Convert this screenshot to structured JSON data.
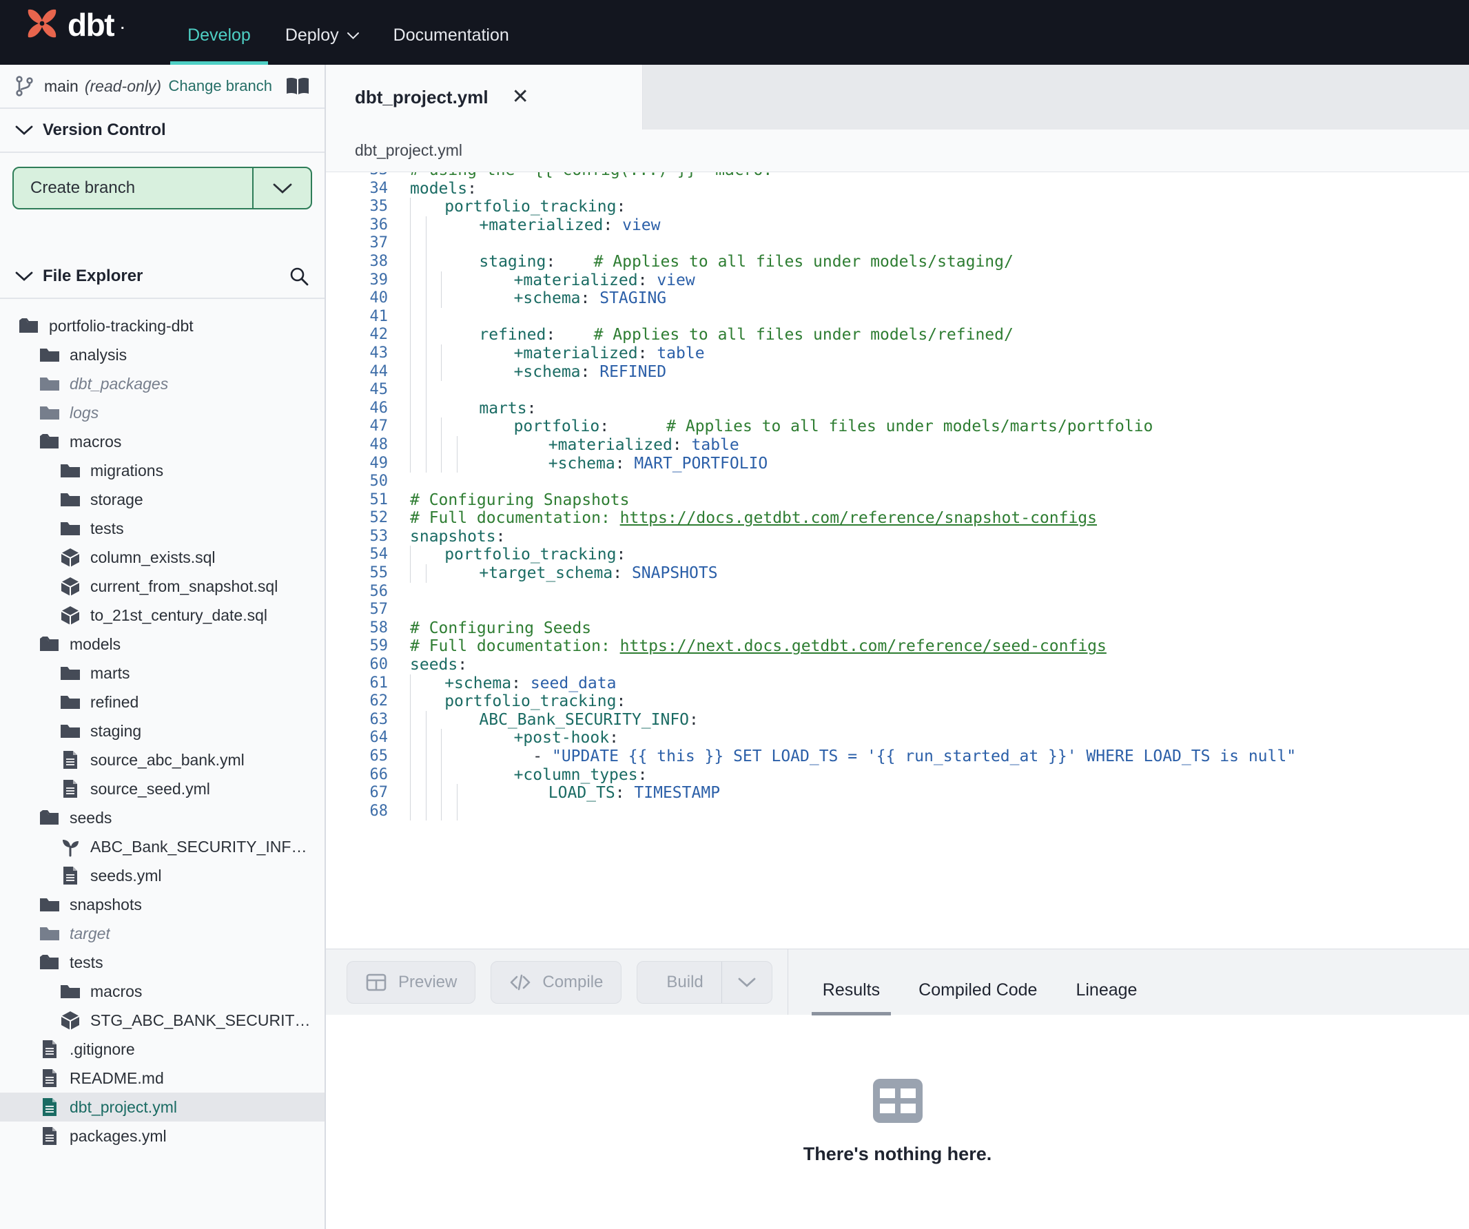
{
  "app": {
    "brand": "dbt",
    "logo_color": "#e8654d"
  },
  "topnav": {
    "items": [
      {
        "label": "Develop",
        "active": true,
        "has_caret": false
      },
      {
        "label": "Deploy",
        "active": false,
        "has_caret": true
      },
      {
        "label": "Documentation",
        "active": false,
        "has_caret": false
      }
    ]
  },
  "sidebar": {
    "branch": {
      "name": "main",
      "readonly_label": "(read-only)",
      "change_branch_label": "Change branch",
      "branch_icon": "git-branch-icon",
      "book_icon": "book-icon"
    },
    "version_control": {
      "title": "Version Control",
      "create_branch_label": "Create branch",
      "chevron_icon": "chevron-down-icon"
    },
    "file_explorer": {
      "title": "File Explorer",
      "search_icon": "search-icon",
      "chevron_icon": "chevron-down-icon",
      "tree": [
        {
          "label": "portfolio-tracking-dbt",
          "depth": 0,
          "icon": "folder-open",
          "muted": false,
          "selected": false
        },
        {
          "label": "analysis",
          "depth": 1,
          "icon": "folder",
          "muted": false,
          "selected": false
        },
        {
          "label": "dbt_packages",
          "depth": 1,
          "icon": "folder",
          "muted": true,
          "selected": false
        },
        {
          "label": "logs",
          "depth": 1,
          "icon": "folder",
          "muted": true,
          "selected": false
        },
        {
          "label": "macros",
          "depth": 1,
          "icon": "folder-open",
          "muted": false,
          "selected": false
        },
        {
          "label": "migrations",
          "depth": 2,
          "icon": "folder",
          "muted": false,
          "selected": false
        },
        {
          "label": "storage",
          "depth": 2,
          "icon": "folder",
          "muted": false,
          "selected": false
        },
        {
          "label": "tests",
          "depth": 2,
          "icon": "folder",
          "muted": false,
          "selected": false
        },
        {
          "label": "column_exists.sql",
          "depth": 2,
          "icon": "cube",
          "muted": false,
          "selected": false
        },
        {
          "label": "current_from_snapshot.sql",
          "depth": 2,
          "icon": "cube",
          "muted": false,
          "selected": false
        },
        {
          "label": "to_21st_century_date.sql",
          "depth": 2,
          "icon": "cube",
          "muted": false,
          "selected": false
        },
        {
          "label": "models",
          "depth": 1,
          "icon": "folder-open",
          "muted": false,
          "selected": false
        },
        {
          "label": "marts",
          "depth": 2,
          "icon": "folder",
          "muted": false,
          "selected": false
        },
        {
          "label": "refined",
          "depth": 2,
          "icon": "folder",
          "muted": false,
          "selected": false
        },
        {
          "label": "staging",
          "depth": 2,
          "icon": "folder",
          "muted": false,
          "selected": false
        },
        {
          "label": "source_abc_bank.yml",
          "depth": 2,
          "icon": "file",
          "muted": false,
          "selected": false
        },
        {
          "label": "source_seed.yml",
          "depth": 2,
          "icon": "file",
          "muted": false,
          "selected": false
        },
        {
          "label": "seeds",
          "depth": 1,
          "icon": "folder-open",
          "muted": false,
          "selected": false
        },
        {
          "label": "ABC_Bank_SECURITY_INFO.csv",
          "depth": 2,
          "icon": "sprout",
          "muted": false,
          "selected": false
        },
        {
          "label": "seeds.yml",
          "depth": 2,
          "icon": "file",
          "muted": false,
          "selected": false
        },
        {
          "label": "snapshots",
          "depth": 1,
          "icon": "folder",
          "muted": false,
          "selected": false
        },
        {
          "label": "target",
          "depth": 1,
          "icon": "folder",
          "muted": true,
          "selected": false
        },
        {
          "label": "tests",
          "depth": 1,
          "icon": "folder-open",
          "muted": false,
          "selected": false
        },
        {
          "label": "macros",
          "depth": 2,
          "icon": "folder",
          "muted": false,
          "selected": false
        },
        {
          "label": "STG_ABC_BANK_SECURITY_INFO__NO_CLASH_D…",
          "depth": 2,
          "icon": "cube",
          "muted": false,
          "selected": false
        },
        {
          "label": ".gitignore",
          "depth": 1,
          "icon": "file",
          "muted": false,
          "selected": false
        },
        {
          "label": "README.md",
          "depth": 1,
          "icon": "file",
          "muted": false,
          "selected": false
        },
        {
          "label": "dbt_project.yml",
          "depth": 1,
          "icon": "file",
          "muted": false,
          "selected": true
        },
        {
          "label": "packages.yml",
          "depth": 1,
          "icon": "file",
          "muted": false,
          "selected": false
        }
      ]
    }
  },
  "editor": {
    "tab": {
      "title": "dbt_project.yml",
      "close_icon": "close-icon"
    },
    "breadcrumb": "dbt_project.yml",
    "first_visible_line": 33,
    "lines": [
      {
        "n": 33,
        "guides": 0,
        "clipped": true,
        "tokens": [
          {
            "t": "# using the \"{{ config(...) }}\" macro.",
            "c": "c"
          }
        ]
      },
      {
        "n": 34,
        "guides": 0,
        "tokens": [
          {
            "t": "models",
            "c": "k"
          },
          {
            "t": ":",
            "c": "p"
          }
        ]
      },
      {
        "n": 35,
        "guides": 1,
        "tokens": [
          {
            "t": "  portfolio_tracking",
            "c": "k"
          },
          {
            "t": ":",
            "c": "p"
          }
        ]
      },
      {
        "n": 36,
        "guides": 2,
        "tokens": [
          {
            "t": "    +materialized",
            "c": "k"
          },
          {
            "t": ": ",
            "c": "p"
          },
          {
            "t": "view",
            "c": "v"
          }
        ]
      },
      {
        "n": 37,
        "guides": 2,
        "tokens": []
      },
      {
        "n": 38,
        "guides": 2,
        "tokens": [
          {
            "t": "    staging",
            "c": "k"
          },
          {
            "t": ":",
            "c": "p"
          },
          {
            "t": "    # Applies to all files under models/staging/",
            "c": "c"
          }
        ]
      },
      {
        "n": 39,
        "guides": 3,
        "tokens": [
          {
            "t": "      +materialized",
            "c": "k"
          },
          {
            "t": ": ",
            "c": "p"
          },
          {
            "t": "view",
            "c": "v"
          }
        ]
      },
      {
        "n": 40,
        "guides": 3,
        "tokens": [
          {
            "t": "      +schema",
            "c": "k"
          },
          {
            "t": ": ",
            "c": "p"
          },
          {
            "t": "STAGING",
            "c": "v"
          }
        ]
      },
      {
        "n": 41,
        "guides": 2,
        "tokens": []
      },
      {
        "n": 42,
        "guides": 2,
        "tokens": [
          {
            "t": "    refined",
            "c": "k"
          },
          {
            "t": ":",
            "c": "p"
          },
          {
            "t": "    # Applies to all files under models/refined/",
            "c": "c"
          }
        ]
      },
      {
        "n": 43,
        "guides": 3,
        "tokens": [
          {
            "t": "      +materialized",
            "c": "k"
          },
          {
            "t": ": ",
            "c": "p"
          },
          {
            "t": "table",
            "c": "v"
          }
        ]
      },
      {
        "n": 44,
        "guides": 3,
        "tokens": [
          {
            "t": "      +schema",
            "c": "k"
          },
          {
            "t": ": ",
            "c": "p"
          },
          {
            "t": "REFINED",
            "c": "v"
          }
        ]
      },
      {
        "n": 45,
        "guides": 2,
        "tokens": []
      },
      {
        "n": 46,
        "guides": 2,
        "tokens": [
          {
            "t": "    marts",
            "c": "k"
          },
          {
            "t": ":",
            "c": "p"
          }
        ]
      },
      {
        "n": 47,
        "guides": 3,
        "tokens": [
          {
            "t": "      portfolio",
            "c": "k"
          },
          {
            "t": ":",
            "c": "p"
          },
          {
            "t": "      # Applies to all files under models/marts/portfolio",
            "c": "c"
          }
        ]
      },
      {
        "n": 48,
        "guides": 4,
        "tokens": [
          {
            "t": "        +materialized",
            "c": "k"
          },
          {
            "t": ": ",
            "c": "p"
          },
          {
            "t": "table",
            "c": "v"
          }
        ]
      },
      {
        "n": 49,
        "guides": 4,
        "tokens": [
          {
            "t": "        +schema",
            "c": "k"
          },
          {
            "t": ": ",
            "c": "p"
          },
          {
            "t": "MART_PORTFOLIO",
            "c": "v"
          }
        ]
      },
      {
        "n": 50,
        "guides": 0,
        "tokens": []
      },
      {
        "n": 51,
        "guides": 0,
        "tokens": [
          {
            "t": "# Configuring Snapshots",
            "c": "c"
          }
        ]
      },
      {
        "n": 52,
        "guides": 0,
        "tokens": [
          {
            "t": "# Full documentation: ",
            "c": "c"
          },
          {
            "t": "https://docs.getdbt.com/reference/snapshot-configs",
            "c": "lnk"
          }
        ]
      },
      {
        "n": 53,
        "guides": 0,
        "tokens": [
          {
            "t": "snapshots",
            "c": "k"
          },
          {
            "t": ":",
            "c": "p"
          }
        ]
      },
      {
        "n": 54,
        "guides": 1,
        "tokens": [
          {
            "t": "  portfolio_tracking",
            "c": "k"
          },
          {
            "t": ":",
            "c": "p"
          }
        ]
      },
      {
        "n": 55,
        "guides": 2,
        "tokens": [
          {
            "t": "    +target_schema",
            "c": "k"
          },
          {
            "t": ": ",
            "c": "p"
          },
          {
            "t": "SNAPSHOTS",
            "c": "v"
          }
        ]
      },
      {
        "n": 56,
        "guides": 0,
        "tokens": []
      },
      {
        "n": 57,
        "guides": 0,
        "tokens": []
      },
      {
        "n": 58,
        "guides": 0,
        "tokens": [
          {
            "t": "# Configuring Seeds",
            "c": "c"
          }
        ]
      },
      {
        "n": 59,
        "guides": 0,
        "tokens": [
          {
            "t": "# Full documentation: ",
            "c": "c"
          },
          {
            "t": "https://next.docs.getdbt.com/reference/seed-configs",
            "c": "lnk"
          }
        ]
      },
      {
        "n": 60,
        "guides": 0,
        "tokens": [
          {
            "t": "seeds",
            "c": "k"
          },
          {
            "t": ":",
            "c": "p"
          }
        ]
      },
      {
        "n": 61,
        "guides": 1,
        "tokens": [
          {
            "t": "  +schema",
            "c": "k"
          },
          {
            "t": ": ",
            "c": "p"
          },
          {
            "t": "seed_data",
            "c": "v"
          }
        ]
      },
      {
        "n": 62,
        "guides": 1,
        "tokens": [
          {
            "t": "  portfolio_tracking",
            "c": "k"
          },
          {
            "t": ":",
            "c": "p"
          }
        ]
      },
      {
        "n": 63,
        "guides": 2,
        "tokens": [
          {
            "t": "    ABC_Bank_SECURITY_INFO",
            "c": "k"
          },
          {
            "t": ":",
            "c": "p"
          }
        ]
      },
      {
        "n": 64,
        "guides": 3,
        "tokens": [
          {
            "t": "      +post-hook",
            "c": "k"
          },
          {
            "t": ":",
            "c": "p"
          }
        ]
      },
      {
        "n": 65,
        "guides": 3,
        "tokens": [
          {
            "t": "        - ",
            "c": "p"
          },
          {
            "t": "\"UPDATE {{ this }} SET LOAD_TS = '{{ run_started_at }}' WHERE LOAD_TS is null\"",
            "c": "s"
          }
        ]
      },
      {
        "n": 66,
        "guides": 3,
        "tokens": [
          {
            "t": "      +column_types",
            "c": "k"
          },
          {
            "t": ":",
            "c": "p"
          }
        ]
      },
      {
        "n": 67,
        "guides": 4,
        "tokens": [
          {
            "t": "        LOAD_TS",
            "c": "k"
          },
          {
            "t": ": ",
            "c": "p"
          },
          {
            "t": "TIMESTAMP",
            "c": "v"
          }
        ]
      },
      {
        "n": 68,
        "guides": 4,
        "clipped_bottom": true,
        "tokens": []
      }
    ]
  },
  "toolbar": {
    "preview_label": "Preview",
    "preview_icon": "table-icon",
    "compile_label": "Compile",
    "compile_icon": "code-brackets-icon",
    "build_label": "Build",
    "build_icon": "hammer-icon",
    "build_caret_icon": "chevron-down-icon",
    "disabled": true
  },
  "results": {
    "tabs": [
      {
        "label": "Results",
        "active": true
      },
      {
        "label": "Compiled Code",
        "active": false
      },
      {
        "label": "Lineage",
        "active": false
      }
    ],
    "empty_state": {
      "icon": "table-grid-icon",
      "message": "There's nothing here."
    }
  }
}
